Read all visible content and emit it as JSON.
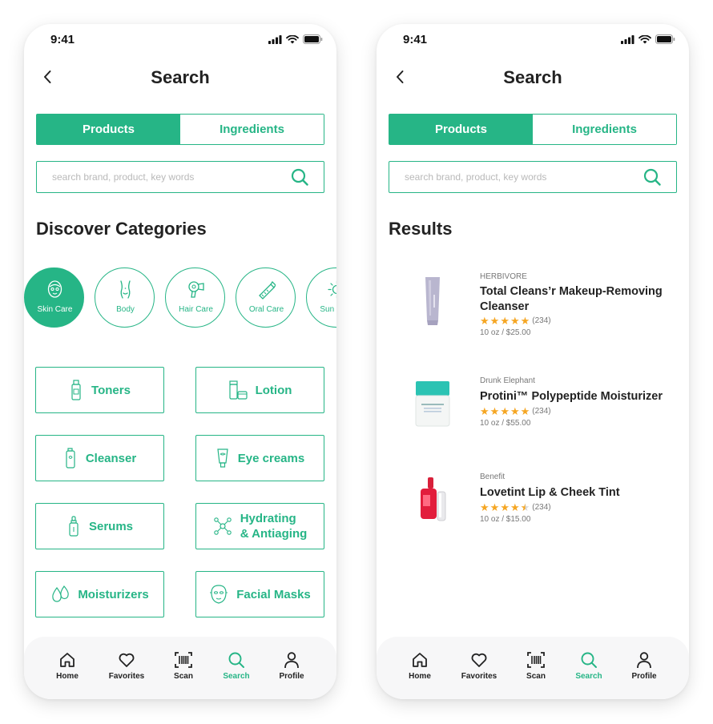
{
  "colors": {
    "accent": "#26b586",
    "star": "#f5a623"
  },
  "screens": [
    {
      "status": {
        "time": "9:41"
      },
      "title": "Search",
      "segmented": {
        "products": "Products",
        "ingredients": "Ingredients",
        "active": "products"
      },
      "search": {
        "placeholder": "search brand, product, key words",
        "value": ""
      },
      "section_title": "Discover Categories",
      "categories": [
        {
          "label": "Skin Care",
          "icon": "face-mask-icon",
          "selected": true
        },
        {
          "label": "Body",
          "icon": "body-icon"
        },
        {
          "label": "Hair Care",
          "icon": "hair-dryer-icon"
        },
        {
          "label": "Oral Care",
          "icon": "toothbrush-icon"
        },
        {
          "label": "Sun Care",
          "icon": "sun-icon"
        }
      ],
      "tiles": [
        {
          "label": "Toners",
          "icon": "toner-bottle-icon"
        },
        {
          "label": "Lotion",
          "icon": "lotion-jars-icon"
        },
        {
          "label": "Cleanser",
          "icon": "cleanser-bottle-icon"
        },
        {
          "label": "Eye creams",
          "icon": "eye-cream-tube-icon"
        },
        {
          "label": "Serums",
          "icon": "serum-dropper-icon"
        },
        {
          "label": "Hydrating\n& Antiaging",
          "icon": "molecule-icon"
        },
        {
          "label": "Moisturizers",
          "icon": "droplets-icon"
        },
        {
          "label": "Facial Masks",
          "icon": "sheet-mask-icon"
        }
      ]
    },
    {
      "status": {
        "time": "9:41"
      },
      "title": "Search",
      "segmented": {
        "products": "Products",
        "ingredients": "Ingredients",
        "active": "products"
      },
      "search": {
        "placeholder": "search brand, product, key words",
        "value": ""
      },
      "section_title": "Results",
      "results": [
        {
          "brand": "HERBIVORE",
          "name": "Total Cleans’r Makeup-Removing Cleanser",
          "rating": 5,
          "count": "(234)",
          "price": "10 oz / $25.00",
          "image": "lavender-tube"
        },
        {
          "brand": "Drunk Elephant",
          "name": "Protini™ Polypeptide Moisturizer",
          "rating": 5,
          "count": "(234)",
          "price": "10 oz / $55.00",
          "image": "teal-jar"
        },
        {
          "brand": "Benefit",
          "name": "Lovetint Lip & Cheek Tint",
          "rating": 4.5,
          "count": "(234)",
          "price": "10 oz / $15.00",
          "image": "red-tint-bottle"
        }
      ]
    }
  ],
  "tabbar": [
    {
      "label": "Home",
      "icon": "home-icon"
    },
    {
      "label": "Favorites",
      "icon": "heart-icon"
    },
    {
      "label": "Scan",
      "icon": "barcode-icon"
    },
    {
      "label": "Search",
      "icon": "search-icon",
      "active": true
    },
    {
      "label": "Profile",
      "icon": "user-icon"
    }
  ]
}
